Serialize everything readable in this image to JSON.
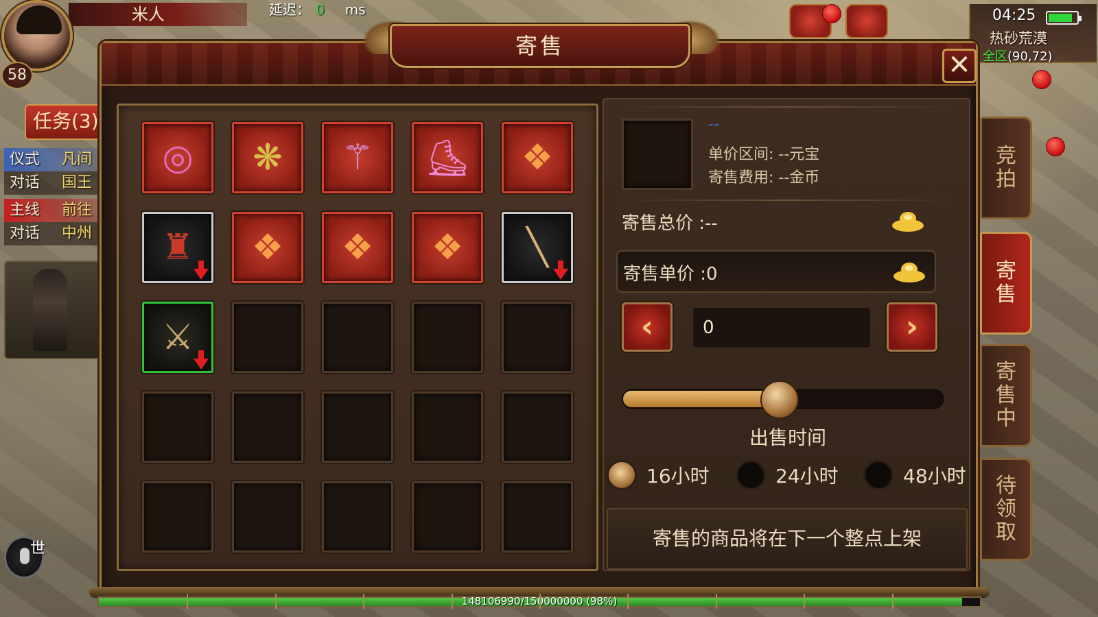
{
  "player": {
    "level": "58",
    "name": "米人"
  },
  "network": {
    "latency_label": "延迟：",
    "latency_value": "0",
    "latency_unit": "ms"
  },
  "status": {
    "clock": "04:25",
    "battery_level": 0.8,
    "map_name": "热砂荒漠",
    "zone": "全区",
    "coords": "(90,72)"
  },
  "quests": {
    "tab_label": "任务(3)",
    "rows": [
      {
        "type": "仪式",
        "dest": "凡间"
      },
      {
        "type": "对话",
        "dest": "国王"
      },
      {
        "type": "主线",
        "dest": "前往"
      },
      {
        "type": "对话",
        "dest": "中州"
      }
    ]
  },
  "voice": {
    "label": "世"
  },
  "dialog": {
    "title": "寄售",
    "close_symbol": "✕"
  },
  "inventory": {
    "slots": [
      {
        "kind": "red",
        "icon": "bracelet-icon",
        "glyph": "◎",
        "color": "#e06bc0",
        "arrow": false
      },
      {
        "kind": "red",
        "icon": "fan-icon",
        "glyph": "❋",
        "color": "#d7c04a",
        "arrow": false
      },
      {
        "kind": "red",
        "icon": "staff-icon",
        "glyph": "⚚",
        "color": "#d9a0ff",
        "arrow": false
      },
      {
        "kind": "red",
        "icon": "boots-icon",
        "glyph": "⛸",
        "color": "#f08ad8",
        "arrow": false
      },
      {
        "kind": "red",
        "icon": "dragon-emblem-icon",
        "glyph": "❖",
        "color": "#f7a04a",
        "arrow": false
      },
      {
        "kind": "white",
        "icon": "armor-robe-icon",
        "glyph": "♜",
        "color": "#c83a2a",
        "arrow": true
      },
      {
        "kind": "red",
        "icon": "dragon-emblem-icon",
        "glyph": "❖",
        "color": "#f7a04a",
        "arrow": false
      },
      {
        "kind": "red",
        "icon": "dragon-emblem-icon",
        "glyph": "❖",
        "color": "#f7a04a",
        "arrow": false
      },
      {
        "kind": "red",
        "icon": "dragon-emblem-icon",
        "glyph": "❖",
        "color": "#f7a04a",
        "arrow": false
      },
      {
        "kind": "white",
        "icon": "sword-icon",
        "glyph": "╲",
        "color": "#d9b078",
        "arrow": true
      },
      {
        "kind": "green",
        "icon": "axe-icon",
        "glyph": "⚔",
        "color": "#c9a870",
        "arrow": true
      },
      {
        "kind": "empty"
      },
      {
        "kind": "empty"
      },
      {
        "kind": "empty"
      },
      {
        "kind": "empty"
      },
      {
        "kind": "empty"
      },
      {
        "kind": "empty"
      },
      {
        "kind": "empty"
      },
      {
        "kind": "empty"
      },
      {
        "kind": "empty"
      },
      {
        "kind": "empty"
      },
      {
        "kind": "empty"
      },
      {
        "kind": "empty"
      },
      {
        "kind": "empty"
      },
      {
        "kind": "empty"
      }
    ]
  },
  "form": {
    "item_name": "--",
    "price_range": "单价区间: --元宝",
    "fee": "寄售费用: --金币",
    "total_price": "寄售总价 :--",
    "unit_price": "寄售单价 :0",
    "prev_symbol": "‹",
    "next_symbol": "›",
    "qty_value": "0",
    "slider_level": 0.49,
    "sale_time_label": "出售时间",
    "durations": [
      {
        "label": "16小时",
        "checked": true
      },
      {
        "label": "24小时",
        "checked": false
      },
      {
        "label": "48小时",
        "checked": false
      }
    ],
    "notice": "寄售的商品将在下一个整点上架",
    "ingot_color": "#f2c43a"
  },
  "side_tabs": [
    {
      "label": "竞拍",
      "active": false
    },
    {
      "label": "寄售",
      "active": true
    },
    {
      "label": "寄售中",
      "active": false
    },
    {
      "label": "待领取",
      "active": false
    }
  ],
  "xp": {
    "text": "148106990/150000000 (98%)",
    "fraction": 0.98
  }
}
